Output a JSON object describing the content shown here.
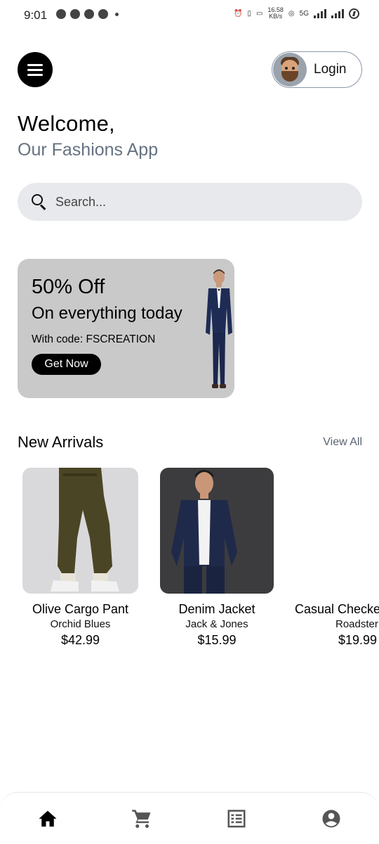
{
  "status_bar": {
    "time": "9:01",
    "net_speed_value": "16.58",
    "net_speed_unit": "KB/s",
    "network": "5G"
  },
  "header": {
    "login_label": "Login"
  },
  "welcome": {
    "title": "Welcome,",
    "subtitle": "Our Fashions App"
  },
  "search": {
    "placeholder": "Search..."
  },
  "promo": {
    "title": "50% Off",
    "subtitle": "On everything today",
    "code_text": "With code: FSCREATION",
    "button_label": "Get Now"
  },
  "new_arrivals": {
    "title": "New Arrivals",
    "view_all": "View All",
    "products": [
      {
        "name": "Olive Cargo Pant",
        "brand": "Orchid Blues",
        "price": "$42.99"
      },
      {
        "name": "Denim Jacket",
        "brand": "Jack & Jones",
        "price": "$15.99"
      },
      {
        "name": "Casual Checke",
        "brand": "Roadster",
        "price": "$19.99"
      }
    ]
  },
  "bottom_nav": {
    "items": [
      "home-icon",
      "cart-icon",
      "orders-icon",
      "profile-icon"
    ]
  },
  "colors": {
    "accent": "#000000",
    "subtitle": "#667282",
    "search_bg": "#e8e9ec",
    "promo_bg": "#c9c9c9"
  }
}
